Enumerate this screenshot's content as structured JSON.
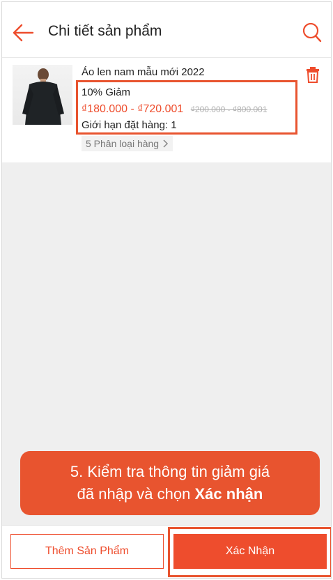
{
  "header": {
    "title": "Chi tiết sản phẩm"
  },
  "product": {
    "name": "Áo len nam mẫu mới 2022",
    "discount": "10% Giảm",
    "price_new": "₫180.000 - ₫720.001",
    "price_old": "₫200.000 - ₫800.001",
    "order_limit": "Giới hạn đặt hàng: 1",
    "variants": "5 Phân loại hàng"
  },
  "callout": {
    "line1": "5. Kiểm tra thông tin giảm giá",
    "line2_prefix": "đã nhập và chọn",
    "line2_bold": "Xác nhận"
  },
  "footer": {
    "add_label": "Thêm Sản Phẩm",
    "confirm_label": "Xác Nhận"
  },
  "colors": {
    "accent": "#ee4d2d",
    "annotation": "#e8542f"
  },
  "icons": [
    "back-arrow-icon",
    "search-icon",
    "trash-icon",
    "chevron-right-icon"
  ]
}
